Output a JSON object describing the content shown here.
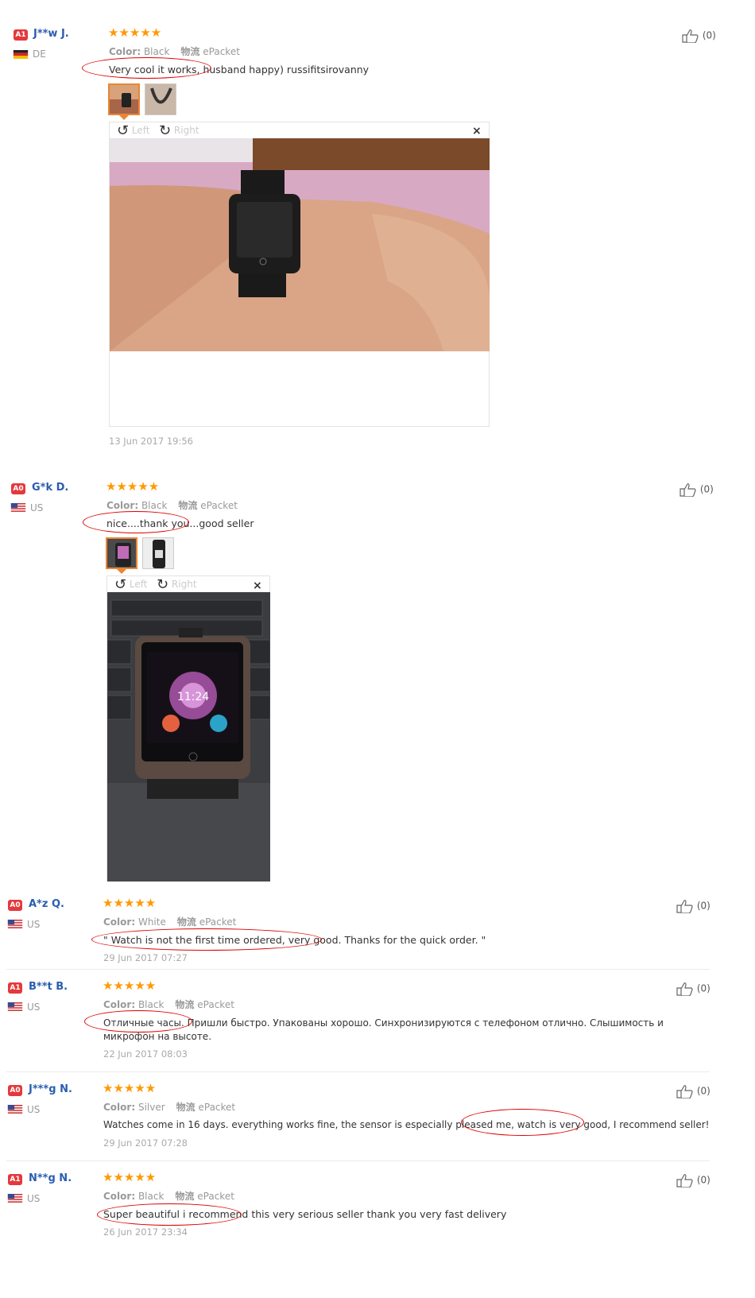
{
  "colors": {
    "badge": "#e4393c",
    "star": "#ff9900",
    "username": "#2a5db0",
    "annotation": "#d00"
  },
  "reviews": [
    {
      "badge": "A1",
      "user": "J**w J.",
      "country": "DE",
      "stars": "★★★★★",
      "color_label": "Color:",
      "color_value": "Black",
      "shipping_label": "物流",
      "shipping_value": "ePacket",
      "text": "Very cool it works, husband happy) russifitsirovanny",
      "viewer": {
        "left": "Left",
        "right": "Right",
        "close": "×"
      },
      "date": "13 Jun 2017 19:56",
      "likes": "(0)"
    },
    {
      "badge": "A0",
      "user": "G*k D.",
      "country": "US",
      "stars": "★★★★★",
      "color_label": "Color:",
      "color_value": "Black",
      "shipping_label": "物流",
      "shipping_value": "ePacket",
      "text": "nice....thank you...good seller",
      "viewer": {
        "left": "Left",
        "right": "Right",
        "close": "×"
      },
      "likes": "(0)"
    },
    {
      "badge": "A0",
      "user": "A*z Q.",
      "country": "US",
      "stars": "★★★★★",
      "color_label": "Color:",
      "color_value": "White",
      "shipping_label": "物流",
      "shipping_value": "ePacket",
      "text": "\" Watch is not the first time ordered, very good. Thanks for the quick order. \"",
      "date": "29 Jun 2017 07:27",
      "likes": "(0)"
    },
    {
      "badge": "A1",
      "user": "B**t B.",
      "country": "US",
      "stars": "★★★★★",
      "color_label": "Color:",
      "color_value": "Black",
      "shipping_label": "物流",
      "shipping_value": "ePacket",
      "text": "Отличные часы. Пришли быстро. Упакованы хорошо. Синхронизируются с телефоном отлично. Слышимость и микрофон на высоте.",
      "date": "22 Jun 2017 08:03",
      "likes": "(0)"
    },
    {
      "badge": "A0",
      "user": "J***g N.",
      "country": "US",
      "stars": "★★★★★",
      "color_label": "Color:",
      "color_value": "Silver",
      "shipping_label": "物流",
      "shipping_value": "ePacket",
      "text": "Watches come in 16 days. everything works fine, the sensor is especially pleased me, watch is very good, I recommend seller!",
      "date": "29 Jun 2017 07:28",
      "likes": "(0)"
    },
    {
      "badge": "A1",
      "user": "N**g N.",
      "country": "US",
      "stars": "★★★★★",
      "color_label": "Color:",
      "color_value": "Black",
      "shipping_label": "物流",
      "shipping_value": "ePacket",
      "text": "Super beautiful i recommend this very serious seller thank you very fast delivery",
      "date": "26 Jun 2017 23:34",
      "likes": "(0)"
    }
  ]
}
